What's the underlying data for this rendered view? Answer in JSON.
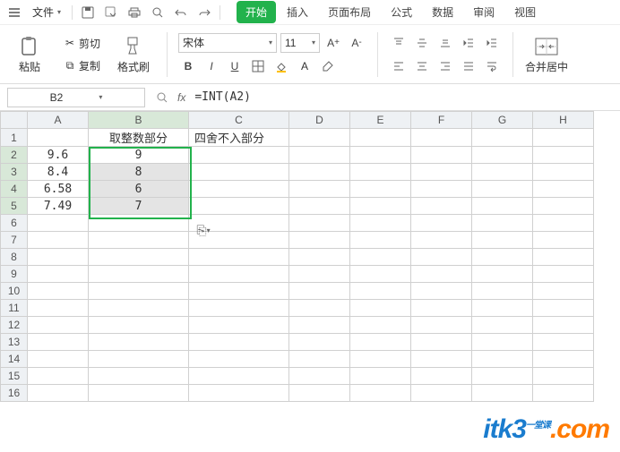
{
  "menubar": {
    "file_label": "文件",
    "tabs": [
      "开始",
      "插入",
      "页面布局",
      "公式",
      "数据",
      "审阅",
      "视图"
    ],
    "active_tab": 0
  },
  "ribbon": {
    "paste": "粘贴",
    "cut": "剪切",
    "copy": "复制",
    "format_painter": "格式刷",
    "font_name": "宋体",
    "font_size": "11",
    "merge_center": "合并居中"
  },
  "formula_bar": {
    "name_box": "B2",
    "fx_symbol": "fx",
    "formula": "=INT(A2)"
  },
  "columns": [
    "A",
    "B",
    "C",
    "D",
    "E",
    "F",
    "G",
    "H"
  ],
  "rows": [
    1,
    2,
    3,
    4,
    5,
    6,
    7,
    8,
    9,
    10,
    11,
    12,
    13,
    14,
    15,
    16
  ],
  "cells": {
    "B1": "取整数部分",
    "C1": "四舍不入部分",
    "A2": "9.6",
    "B2": "9",
    "A3": "8.4",
    "B3": "8",
    "A4": "6.58",
    "B4": "6",
    "A5": "7.49",
    "B5": "7"
  },
  "selection": {
    "start": "B2",
    "end": "B5"
  },
  "fill_icon": "⎘",
  "logo": {
    "brand": "itk3",
    "tld": ".com",
    "tagline": "一堂课"
  }
}
